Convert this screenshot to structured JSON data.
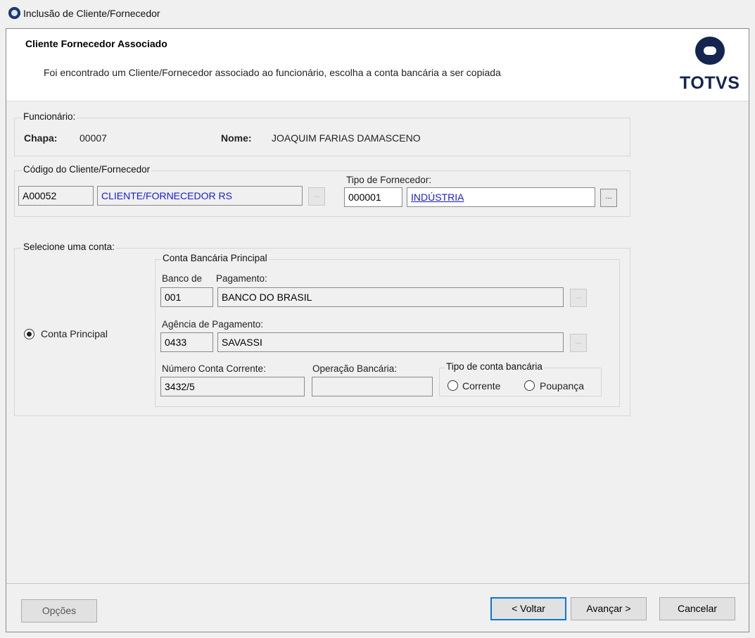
{
  "window": {
    "title": "Inclusão de Cliente/Fornecedor"
  },
  "header": {
    "title": "Cliente Fornecedor Associado",
    "description": "Foi encontrado um Cliente/Fornecedor associado ao funcionário, escolha a conta bancária a ser copiada",
    "logo_text": "TOTVS"
  },
  "funcionario": {
    "legend": "Funcionário:",
    "chapa_label": "Chapa:",
    "chapa_value": "00007",
    "nome_label": "Nome:",
    "nome_value": "JOAQUIM FARIAS DAMASCENO"
  },
  "cliente": {
    "legend": "Código do Cliente/Fornecedor",
    "code": "A00052",
    "name": "CLIENTE/FORNECEDOR RS",
    "button": "...",
    "tipo_label": "Tipo de Fornecedor:",
    "tipo_code": "000001",
    "tipo_name": "INDÚSTRIA",
    "tipo_button": "..."
  },
  "conta": {
    "legend": "Selecione uma conta:",
    "option_label": "Conta Principal",
    "option_selected": true,
    "principal_legend": "Conta Bancária Principal",
    "banco_label_1": "Banco de",
    "banco_label_2": "Pagamento:",
    "banco_code": "001",
    "banco_name": "BANCO DO BRASIL",
    "banco_button": "...",
    "agencia_label": "Agência de Pagamento:",
    "agencia_code": "0433",
    "agencia_name": "SAVASSI",
    "agencia_button": "...",
    "numero_label": "Número Conta Corrente:",
    "numero_value": "3432/5",
    "operacao_label": "Operação Bancária:",
    "operacao_value": "",
    "tipo_legend": "Tipo de conta bancária",
    "tipo_corrente": "Corrente",
    "tipo_poupanca": "Poupança"
  },
  "footer": {
    "opcoes": "Opções",
    "voltar": "< Voltar",
    "avancar": "Avançar >",
    "cancelar": "Cancelar"
  },
  "colors": {
    "accent": "#0a78d7",
    "link": "#1a1ad6",
    "logo": "#14254f"
  }
}
